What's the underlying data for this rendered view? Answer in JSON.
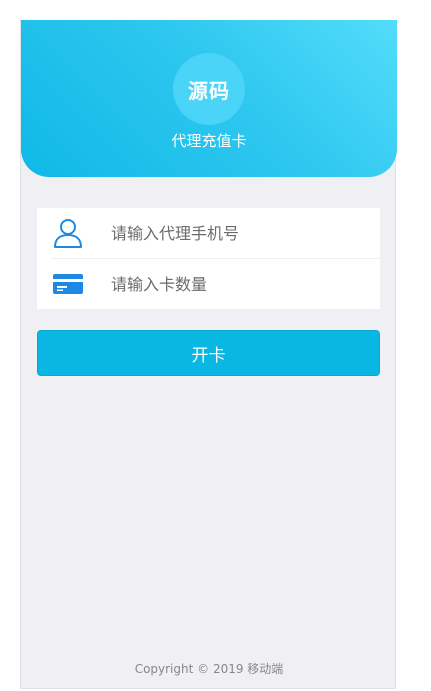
{
  "header": {
    "logo_text": "源码",
    "title": "代理充值卡"
  },
  "form": {
    "phone": {
      "icon": "user-icon",
      "placeholder": "请输入代理手机号",
      "value": ""
    },
    "card_count": {
      "icon": "card-icon",
      "placeholder": "请输入卡数量",
      "value": ""
    }
  },
  "actions": {
    "open_card_label": "开卡"
  },
  "footer": {
    "copyright": "Copyright © 2019 移动端"
  },
  "colors": {
    "accent": "#0ab7e3",
    "hero_gradient_start": "#52dcfa",
    "hero_gradient_end": "#0fb9e6",
    "icon_blue": "#1e88e5",
    "page_bg": "#f0eff4"
  }
}
